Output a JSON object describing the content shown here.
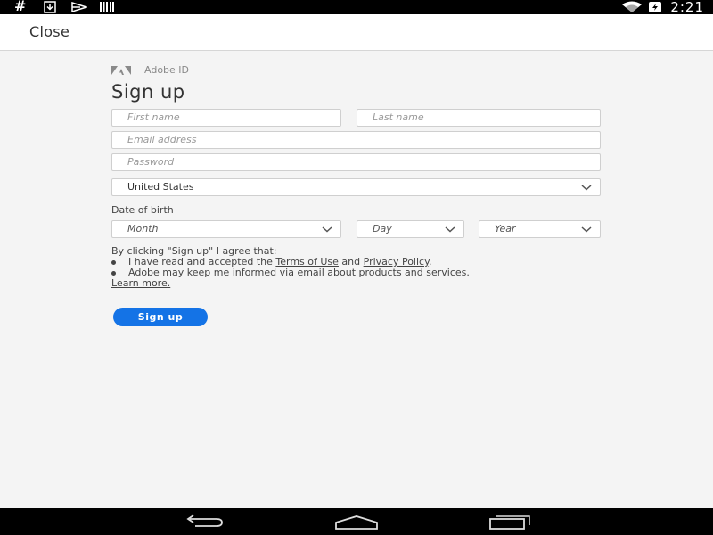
{
  "status_bar": {
    "left_icons": [
      "hash-icon",
      "download-icon",
      "send-icon",
      "barcode-icon"
    ],
    "right_icons": [
      "wifi-icon",
      "battery-icon"
    ],
    "time": "2:21"
  },
  "top_bar": {
    "close_label": "Close"
  },
  "brand": {
    "logo_icon": "adobe-logo-icon",
    "label": "Adobe ID"
  },
  "form": {
    "title": "Sign up",
    "first_name_placeholder": "First name",
    "last_name_placeholder": "Last name",
    "email_placeholder": "Email address",
    "password_placeholder": "Password",
    "country_value": "United States",
    "dob_label": "Date of birth",
    "month_value": "Month",
    "day_value": "Day",
    "year_value": "Year"
  },
  "agreement": {
    "intro": "By clicking \"Sign up\" I agree that:",
    "item1_prefix": "I have read and accepted the ",
    "terms_link": "Terms of Use",
    "item1_mid": " and ",
    "privacy_link": "Privacy Policy",
    "item1_suffix": ".",
    "item2": "Adobe may keep me informed via email about products and services.",
    "learn_more": "Learn more."
  },
  "signup_button_label": "Sign up",
  "nav_bar": {
    "icons": [
      "back-icon",
      "home-icon",
      "recents-icon"
    ]
  },
  "colors": {
    "accent": "#1473e6",
    "status_bar": "#000000",
    "background": "#f4f4f4"
  }
}
